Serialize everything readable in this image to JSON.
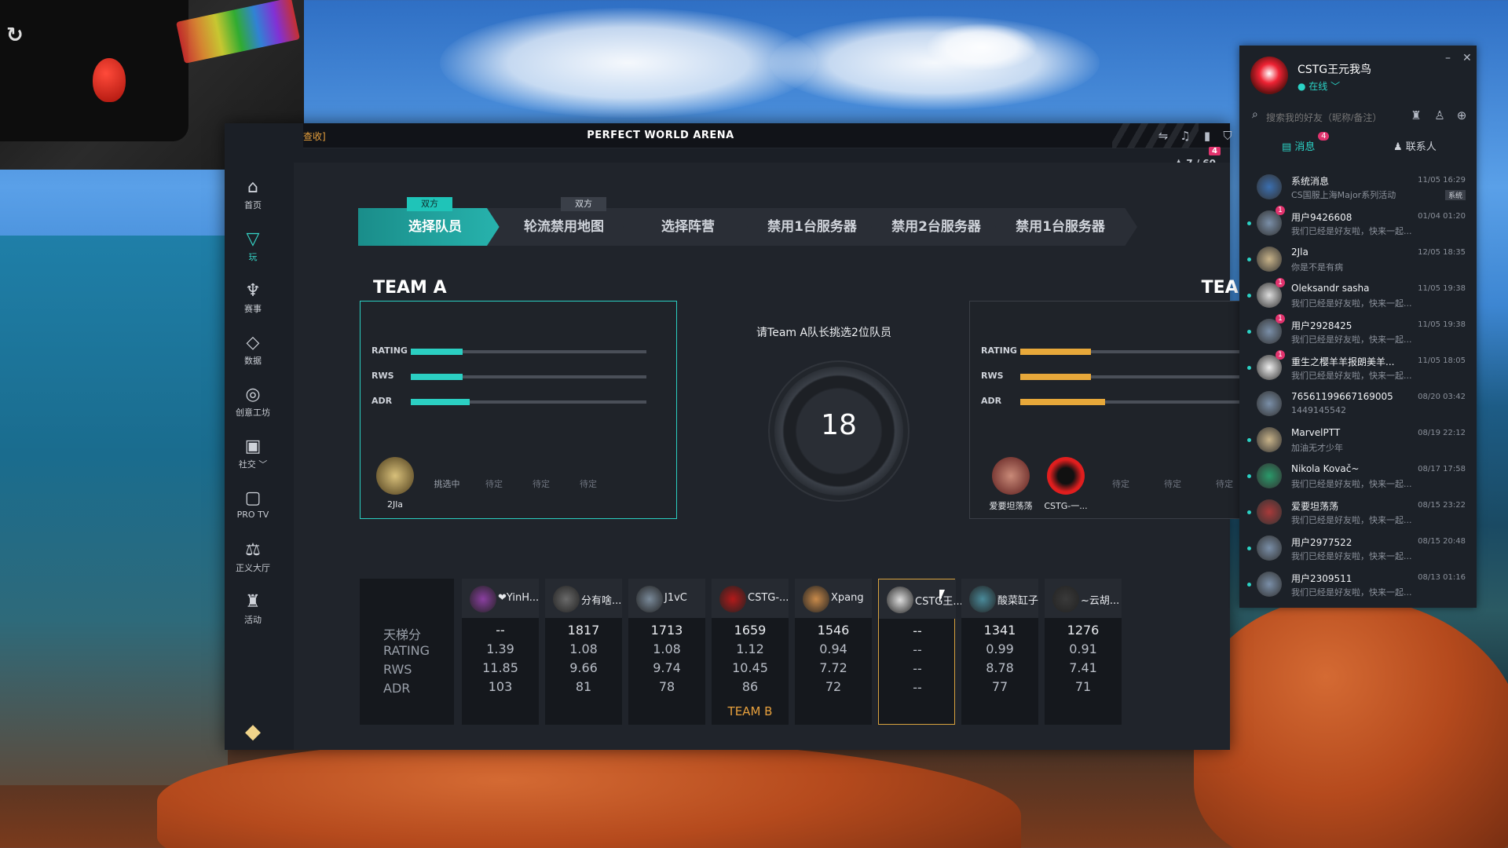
{
  "app": {
    "title": "PERFECT WORLD ARENA",
    "crumb": "查收]",
    "online_count": "7 / 60",
    "online_badge": "4"
  },
  "nav": [
    {
      "label": "首页",
      "icon": "home-icon",
      "glyph": "⌂"
    },
    {
      "label": "玩",
      "icon": "play-icon",
      "glyph": "▽"
    },
    {
      "label": "赛事",
      "icon": "trophy-icon",
      "glyph": "♆"
    },
    {
      "label": "数据",
      "icon": "data-icon",
      "glyph": "◇"
    },
    {
      "label": "创意工坊",
      "icon": "planet-icon",
      "glyph": "◎"
    },
    {
      "label": "社交 ﹀",
      "icon": "social-icon",
      "glyph": "▣"
    },
    {
      "label": "PRO TV",
      "icon": "tv-icon",
      "glyph": "▢"
    },
    {
      "label": "正义大厅",
      "icon": "justice-icon",
      "glyph": "⚖"
    },
    {
      "label": "活动",
      "icon": "event-icon",
      "glyph": "♜"
    }
  ],
  "steps": [
    {
      "label": "选择队员",
      "tag": "双方"
    },
    {
      "label": "轮流禁用地图",
      "tag": "双方"
    },
    {
      "label": "选择阵营",
      "tag": ""
    },
    {
      "label": "禁用1台服务器",
      "tag": ""
    },
    {
      "label": "禁用2台服务器",
      "tag": ""
    },
    {
      "label": "禁用1台服务器",
      "tag": ""
    }
  ],
  "team_a": {
    "title": "TEAM A",
    "stats": [
      {
        "label": "RATING",
        "fill": 0.22
      },
      {
        "label": "RWS",
        "fill": 0.22
      },
      {
        "label": "ADR",
        "fill": 0.25
      }
    ],
    "slots": [
      {
        "name": "2Jla",
        "state": "player"
      },
      {
        "name": "挑选中",
        "state": "picking"
      },
      {
        "name": "待定",
        "state": "pending"
      },
      {
        "name": "待定",
        "state": "pending"
      },
      {
        "name": "待定",
        "state": "pending"
      }
    ]
  },
  "team_b": {
    "title": "TEAM B",
    "stats": [
      {
        "label": "RATING",
        "fill": 0.3
      },
      {
        "label": "RWS",
        "fill": 0.3
      },
      {
        "label": "ADR",
        "fill": 0.36
      }
    ],
    "slots": [
      {
        "name": "爱要坦荡荡",
        "state": "player"
      },
      {
        "name": "CSTG-一...",
        "state": "player"
      },
      {
        "name": "待定",
        "state": "pending"
      },
      {
        "name": "待定",
        "state": "pending"
      },
      {
        "name": "待定",
        "state": "pending"
      }
    ]
  },
  "center": {
    "prompt": "请Team A队长挑选2位队员",
    "timer": "18"
  },
  "row_labels": [
    "天梯分",
    "RATING",
    "RWS",
    "ADR"
  ],
  "players": [
    {
      "name": "❤YinH...",
      "ladder": "--",
      "rating": "1.39",
      "rws": "11.85",
      "adr": "103",
      "team": ""
    },
    {
      "name": "分有啥...",
      "ladder": "1817",
      "rating": "1.08",
      "rws": "9.66",
      "adr": "81",
      "team": ""
    },
    {
      "name": "J1vC",
      "ladder": "1713",
      "rating": "1.08",
      "rws": "9.74",
      "adr": "78",
      "team": ""
    },
    {
      "name": "CSTG-...",
      "ladder": "1659",
      "rating": "1.12",
      "rws": "10.45",
      "adr": "86",
      "team": "TEAM B"
    },
    {
      "name": "Xpang",
      "ladder": "1546",
      "rating": "0.94",
      "rws": "7.72",
      "adr": "72",
      "team": ""
    },
    {
      "name": "CSTG王...",
      "ladder": "--",
      "rating": "--",
      "rws": "--",
      "adr": "--",
      "team": ""
    },
    {
      "name": "酸菜缸子",
      "ladder": "1341",
      "rating": "0.99",
      "rws": "8.78",
      "adr": "77",
      "team": ""
    },
    {
      "name": "~云胡...",
      "ladder": "1276",
      "rating": "0.91",
      "rws": "7.41",
      "adr": "71",
      "team": ""
    }
  ],
  "friends": {
    "user": "CSTG王元我鸟",
    "status": "在线 ﹀",
    "search_placeholder": "搜索我的好友（昵称/备注）",
    "tabs": [
      {
        "label": "消息",
        "badge": "4"
      },
      {
        "label": "联系人",
        "badge": ""
      }
    ],
    "items": [
      {
        "name": "系统消息",
        "msg": "CS国服上海Major系列活动",
        "time": "11/05 16:29",
        "sys": "系统",
        "unread": "",
        "online": false
      },
      {
        "name": "用户9426608",
        "msg": "我们已经是好友啦，快来一起...",
        "time": "01/04 01:20",
        "sys": "",
        "unread": "1",
        "online": true
      },
      {
        "name": "2Jla",
        "msg": "你是不是有病",
        "time": "12/05 18:35",
        "sys": "",
        "unread": "",
        "online": true
      },
      {
        "name": "Oleksandr sasha",
        "msg": "我们已经是好友啦，快来一起...",
        "time": "11/05 19:38",
        "sys": "",
        "unread": "1",
        "online": true
      },
      {
        "name": "用户2928425",
        "msg": "我们已经是好友啦，快来一起...",
        "time": "11/05 19:38",
        "sys": "",
        "unread": "1",
        "online": true
      },
      {
        "name": "重生之樱羊羊报朗美羊...",
        "msg": "我们已经是好友啦，快来一起...",
        "time": "11/05 18:05",
        "sys": "",
        "unread": "1",
        "online": true
      },
      {
        "name": "76561199667169005",
        "msg": "1449145542",
        "time": "08/20 03:42",
        "sys": "",
        "unread": "",
        "online": false
      },
      {
        "name": "MarvelPTT",
        "msg": "加油无才少年",
        "time": "08/19 22:12",
        "sys": "",
        "unread": "",
        "online": true
      },
      {
        "name": "Nikola Kovač~",
        "msg": "我们已经是好友啦，快来一起...",
        "time": "08/17 17:58",
        "sys": "",
        "unread": "",
        "online": true
      },
      {
        "name": "爱要坦荡荡",
        "msg": "我们已经是好友啦，快来一起...",
        "time": "08/15 23:22",
        "sys": "",
        "unread": "",
        "online": true
      },
      {
        "name": "用户2977522",
        "msg": "我们已经是好友啦，快来一起...",
        "time": "08/15 20:48",
        "sys": "",
        "unread": "",
        "online": true
      },
      {
        "name": "用户2309511",
        "msg": "我们已经是好友啦，快来一起...",
        "time": "08/13 01:16",
        "sys": "",
        "unread": "",
        "online": true
      }
    ]
  },
  "colors": {
    "accent": "#2bcfc2",
    "team_b": "#e7a83a",
    "badge": "#e2336e"
  }
}
